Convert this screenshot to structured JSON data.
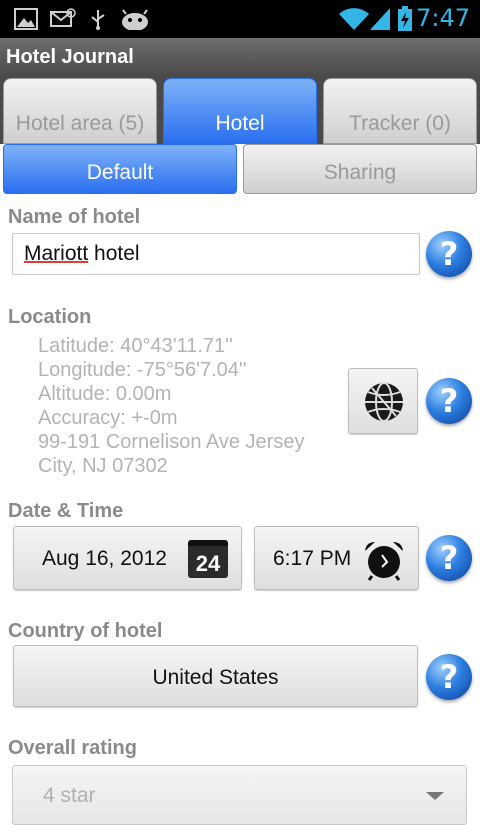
{
  "status_bar": {
    "time": "7:47",
    "icons": [
      "image-icon",
      "mail-icon",
      "usb-icon",
      "android-icon",
      "wifi-icon",
      "signal-icon",
      "battery-icon"
    ],
    "accent_color": "#33b5e5"
  },
  "app": {
    "title": "Hotel Journal"
  },
  "tabs": [
    {
      "label": "Hotel area (5)",
      "active": false
    },
    {
      "label": "Hotel",
      "active": true
    },
    {
      "label": "Tracker (0)",
      "active": false
    }
  ],
  "subtabs": [
    {
      "label": "Default",
      "active": true
    },
    {
      "label": "Sharing",
      "active": false
    }
  ],
  "name_section": {
    "label": "Name of hotel",
    "value_first": "Mariott",
    "value_rest": " hotel"
  },
  "location_section": {
    "label": "Location",
    "latitude": "Latitude: 40°43'11.71''",
    "longitude": "Longitude: -75°56'7.04''",
    "altitude": "Altitude: 0.00m",
    "accuracy": "Accuracy: +-0m",
    "address_line1": "99-191 Cornelison Ave Jersey",
    "address_line2": "City, NJ 07302"
  },
  "datetime_section": {
    "label": "Date & Time",
    "date": "Aug 16, 2012",
    "calendar_day": "24",
    "time": "6:17 PM"
  },
  "country_section": {
    "label": "Country of hotel",
    "value": "United States"
  },
  "rating_section": {
    "label": "Overall rating",
    "value": "4 star"
  },
  "help_glyph": "?"
}
